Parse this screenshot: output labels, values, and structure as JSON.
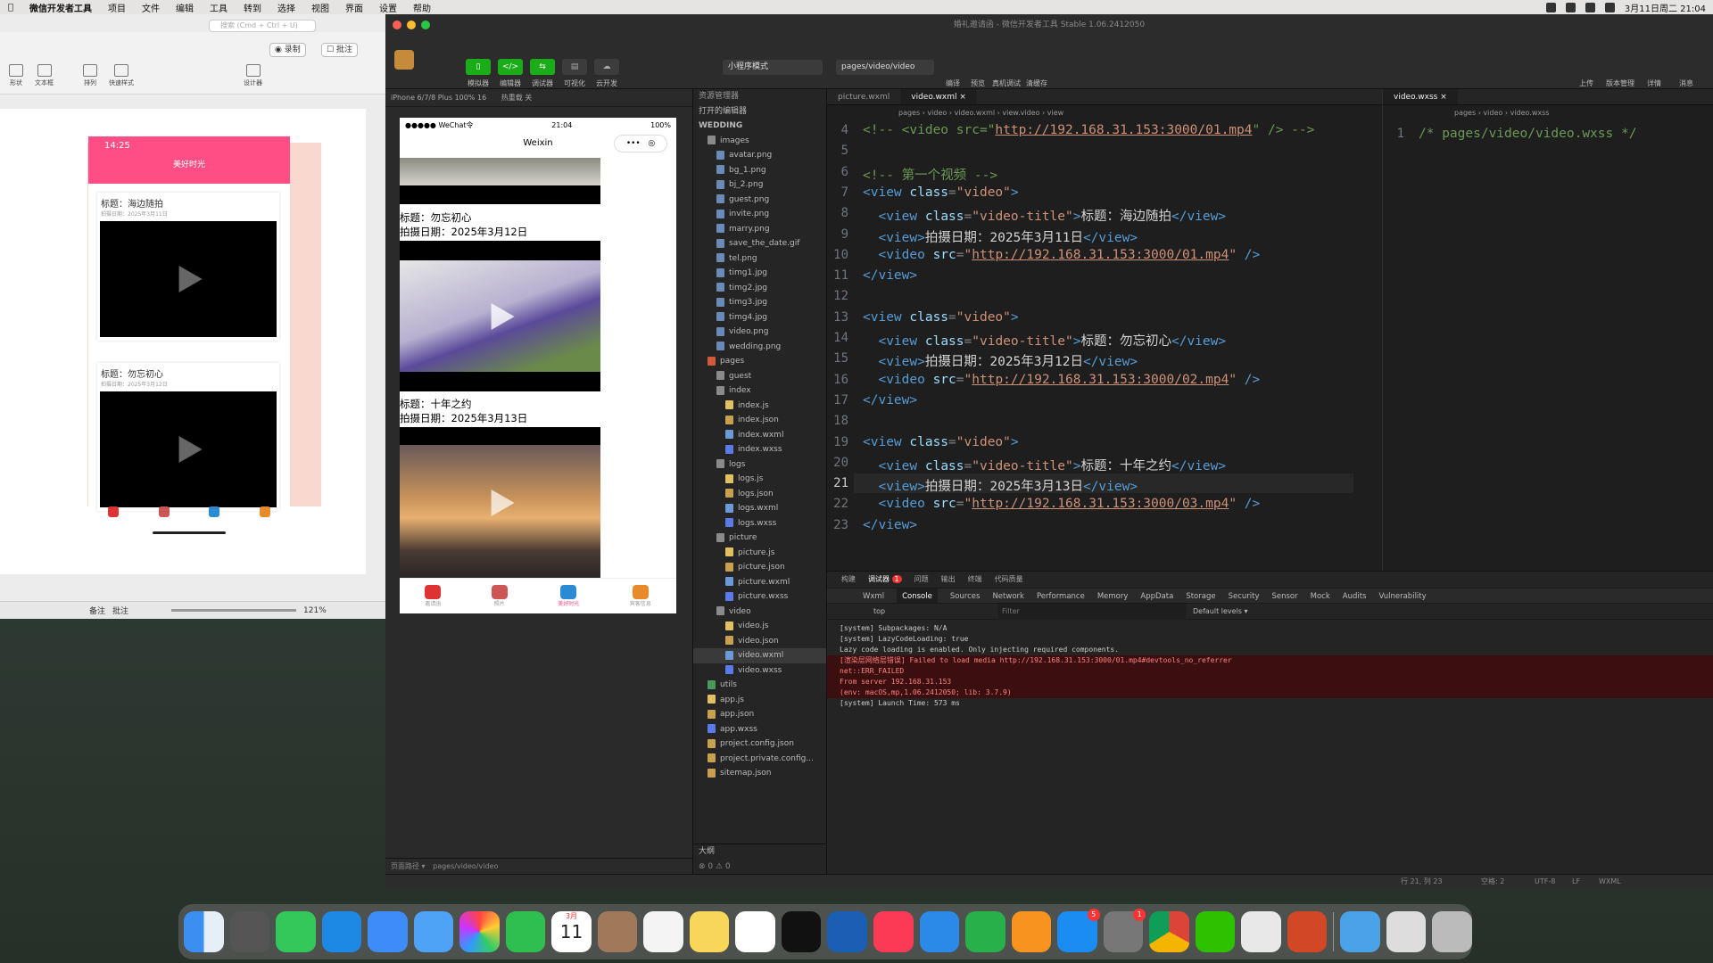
{
  "menubar": {
    "app": "微信开发者工具",
    "items": [
      "项目",
      "文件",
      "编辑",
      "工具",
      "转到",
      "选择",
      "视图",
      "界面",
      "设置",
      "帮助"
    ],
    "datetime": "3月11日周二 21:04"
  },
  "ppt": {
    "search_placeholder": "搜索 (Cmd + Ctrl + U)",
    "record_label": "录制",
    "comment_label": "批注",
    "tools": [
      "形状",
      "文本框",
      "排列",
      "快速样式",
      "设计器"
    ],
    "phone_time": "14:25",
    "phone_title": "美好时光",
    "cards": [
      {
        "title": "标题：海边随拍",
        "date": "拍摄日期：2025年3月11日"
      },
      {
        "title": "标题：勿忘初心",
        "date": "拍摄日期：2025年3月12日"
      }
    ],
    "status_notes": "备注",
    "status_comments": "批注",
    "zoom": "121%"
  },
  "ide": {
    "window_title": "婚礼邀请函 - 微信开发者工具 Stable 1.06.2412050",
    "tool_labels": [
      "模拟器",
      "编辑器",
      "调试器",
      "可视化",
      "云开发"
    ],
    "mode": "小程序模式",
    "page_path": "pages/video/video",
    "right_labels": [
      "编译",
      "预览",
      "真机调试",
      "清缓存"
    ],
    "far_right_labels": [
      "上传",
      "版本管理",
      "详情",
      "消息"
    ],
    "device": "iPhone 6/7/8 Plus 100% 16",
    "network": "热重载 关"
  },
  "phone": {
    "carrier": "●●●●● WeChat令",
    "time": "21:04",
    "battery": "100%",
    "nav_title": "Weixin",
    "items": [
      {
        "title": "标题：勿忘初心",
        "date": "拍摄日期：2025年3月12日"
      },
      {
        "title": "标题：十年之约",
        "date": "拍摄日期：2025年3月13日"
      }
    ],
    "tabs": [
      "邀请函",
      "照片",
      "美好时光",
      "宾客信息"
    ]
  },
  "explorer": {
    "header": "资源管理器",
    "open_editors": "打开的编辑器",
    "project": "WEDDING",
    "rows": [
      {
        "name": "images",
        "depth": 1,
        "type": "folder"
      },
      {
        "name": "avatar.png",
        "depth": 2,
        "type": "img"
      },
      {
        "name": "bg_1.png",
        "depth": 2,
        "type": "img"
      },
      {
        "name": "bj_2.png",
        "depth": 2,
        "type": "img"
      },
      {
        "name": "guest.png",
        "depth": 2,
        "type": "img"
      },
      {
        "name": "invite.png",
        "depth": 2,
        "type": "img"
      },
      {
        "name": "marry.png",
        "depth": 2,
        "type": "img"
      },
      {
        "name": "save_the_date.gif",
        "depth": 2,
        "type": "img"
      },
      {
        "name": "tel.png",
        "depth": 2,
        "type": "img"
      },
      {
        "name": "timg1.jpg",
        "depth": 2,
        "type": "img"
      },
      {
        "name": "timg2.jpg",
        "depth": 2,
        "type": "img"
      },
      {
        "name": "timg3.jpg",
        "depth": 2,
        "type": "img"
      },
      {
        "name": "timg4.jpg",
        "depth": 2,
        "type": "img"
      },
      {
        "name": "video.png",
        "depth": 2,
        "type": "img"
      },
      {
        "name": "wedding.png",
        "depth": 2,
        "type": "img"
      },
      {
        "name": "pages",
        "depth": 1,
        "type": "folder-red"
      },
      {
        "name": "guest",
        "depth": 2,
        "type": "folder"
      },
      {
        "name": "index",
        "depth": 2,
        "type": "folder"
      },
      {
        "name": "index.js",
        "depth": 3,
        "type": "js"
      },
      {
        "name": "index.json",
        "depth": 3,
        "type": "json"
      },
      {
        "name": "index.wxml",
        "depth": 3,
        "type": "wxml"
      },
      {
        "name": "index.wxss",
        "depth": 3,
        "type": "wxss"
      },
      {
        "name": "logs",
        "depth": 2,
        "type": "folder"
      },
      {
        "name": "logs.js",
        "depth": 3,
        "type": "js"
      },
      {
        "name": "logs.json",
        "depth": 3,
        "type": "json"
      },
      {
        "name": "logs.wxml",
        "depth": 3,
        "type": "wxml"
      },
      {
        "name": "logs.wxss",
        "depth": 3,
        "type": "wxss"
      },
      {
        "name": "picture",
        "depth": 2,
        "type": "folder"
      },
      {
        "name": "picture.js",
        "depth": 3,
        "type": "js"
      },
      {
        "name": "picture.json",
        "depth": 3,
        "type": "json"
      },
      {
        "name": "picture.wxml",
        "depth": 3,
        "type": "wxml"
      },
      {
        "name": "picture.wxss",
        "depth": 3,
        "type": "wxss"
      },
      {
        "name": "video",
        "depth": 2,
        "type": "folder"
      },
      {
        "name": "video.js",
        "depth": 3,
        "type": "js"
      },
      {
        "name": "video.json",
        "depth": 3,
        "type": "json"
      },
      {
        "name": "video.wxml",
        "depth": 3,
        "type": "wxml",
        "selected": true
      },
      {
        "name": "video.wxss",
        "depth": 3,
        "type": "wxss"
      },
      {
        "name": "utils",
        "depth": 1,
        "type": "folder-green"
      },
      {
        "name": "app.js",
        "depth": 1,
        "type": "js"
      },
      {
        "name": "app.json",
        "depth": 1,
        "type": "json"
      },
      {
        "name": "app.wxss",
        "depth": 1,
        "type": "wxss"
      },
      {
        "name": "project.config.json",
        "depth": 1,
        "type": "json"
      },
      {
        "name": "project.private.config...",
        "depth": 1,
        "type": "json"
      },
      {
        "name": "sitemap.json",
        "depth": 1,
        "type": "json"
      }
    ],
    "outline": "大纲",
    "errors": "⊗ 0 ⚠ 0"
  },
  "editor": {
    "tabs": [
      "picture.wxml",
      "video.wxml"
    ],
    "breadcrumb": "pages › video › video.wxml › view.video › view",
    "current_line": 21
  },
  "code": [
    {
      "n": 4,
      "parts": [
        [
          "c",
          "<!-- <video src=\""
        ],
        [
          "u",
          "http://192.168.31.153:3000/01.mp4"
        ],
        [
          "c",
          "\" /> -->"
        ]
      ]
    },
    {
      "n": 5,
      "parts": []
    },
    {
      "n": 6,
      "parts": [
        [
          "c",
          "<!-- 第一个视频 -->"
        ]
      ]
    },
    {
      "n": 7,
      "parts": [
        [
          "k",
          "<view "
        ],
        [
          "a",
          "class"
        ],
        [
          "p",
          "="
        ],
        [
          "s",
          "\"video\""
        ],
        [
          "k",
          ">"
        ]
      ]
    },
    {
      "n": 8,
      "parts": [
        [
          "t",
          "  "
        ],
        [
          "k",
          "<view "
        ],
        [
          "a",
          "class"
        ],
        [
          "p",
          "="
        ],
        [
          "s",
          "\"video-title\""
        ],
        [
          "k",
          ">"
        ],
        [
          "t",
          "标题：海边随拍"
        ],
        [
          "k",
          "</view>"
        ]
      ]
    },
    {
      "n": 9,
      "parts": [
        [
          "t",
          "  "
        ],
        [
          "k",
          "<view>"
        ],
        [
          "t",
          "拍摄日期：2025年3月11日"
        ],
        [
          "k",
          "</view>"
        ]
      ]
    },
    {
      "n": 10,
      "parts": [
        [
          "t",
          "  "
        ],
        [
          "k",
          "<video "
        ],
        [
          "a",
          "src"
        ],
        [
          "p",
          "="
        ],
        [
          "s",
          "\""
        ],
        [
          "u",
          "http://192.168.31.153:3000/01.mp4"
        ],
        [
          "s",
          "\""
        ],
        [
          "k",
          " />"
        ]
      ]
    },
    {
      "n": 11,
      "parts": [
        [
          "k",
          "</view>"
        ]
      ]
    },
    {
      "n": 12,
      "parts": []
    },
    {
      "n": 13,
      "parts": [
        [
          "k",
          "<view "
        ],
        [
          "a",
          "class"
        ],
        [
          "p",
          "="
        ],
        [
          "s",
          "\"video\""
        ],
        [
          "k",
          ">"
        ]
      ]
    },
    {
      "n": 14,
      "parts": [
        [
          "t",
          "  "
        ],
        [
          "k",
          "<view "
        ],
        [
          "a",
          "class"
        ],
        [
          "p",
          "="
        ],
        [
          "s",
          "\"video-title\""
        ],
        [
          "k",
          ">"
        ],
        [
          "t",
          "标题：勿忘初心"
        ],
        [
          "k",
          "</view>"
        ]
      ]
    },
    {
      "n": 15,
      "parts": [
        [
          "t",
          "  "
        ],
        [
          "k",
          "<view>"
        ],
        [
          "t",
          "拍摄日期：2025年3月12日"
        ],
        [
          "k",
          "</view>"
        ]
      ]
    },
    {
      "n": 16,
      "parts": [
        [
          "t",
          "  "
        ],
        [
          "k",
          "<video "
        ],
        [
          "a",
          "src"
        ],
        [
          "p",
          "="
        ],
        [
          "s",
          "\""
        ],
        [
          "u",
          "http://192.168.31.153:3000/02.mp4"
        ],
        [
          "s",
          "\""
        ],
        [
          "k",
          " />"
        ]
      ]
    },
    {
      "n": 17,
      "parts": [
        [
          "k",
          "</view>"
        ]
      ]
    },
    {
      "n": 18,
      "parts": []
    },
    {
      "n": 19,
      "parts": [
        [
          "k",
          "<view "
        ],
        [
          "a",
          "class"
        ],
        [
          "p",
          "="
        ],
        [
          "s",
          "\"video\""
        ],
        [
          "k",
          ">"
        ]
      ]
    },
    {
      "n": 20,
      "parts": [
        [
          "t",
          "  "
        ],
        [
          "k",
          "<view "
        ],
        [
          "a",
          "class"
        ],
        [
          "p",
          "="
        ],
        [
          "s",
          "\"video-title\""
        ],
        [
          "k",
          ">"
        ],
        [
          "t",
          "标题：十年之约"
        ],
        [
          "k",
          "</view>"
        ]
      ]
    },
    {
      "n": 21,
      "parts": [
        [
          "t",
          "  "
        ],
        [
          "k",
          "<view>"
        ],
        [
          "t",
          "拍摄日期：2025年3月13日"
        ],
        [
          "k",
          "</view>"
        ]
      ]
    },
    {
      "n": 22,
      "parts": [
        [
          "t",
          "  "
        ],
        [
          "k",
          "<video "
        ],
        [
          "a",
          "src"
        ],
        [
          "p",
          "="
        ],
        [
          "s",
          "\""
        ],
        [
          "u",
          "http://192.168.31.153:3000/03.mp4"
        ],
        [
          "s",
          "\""
        ],
        [
          "k",
          " />"
        ]
      ]
    },
    {
      "n": 23,
      "parts": [
        [
          "k",
          "</view>"
        ]
      ]
    }
  ],
  "wxss": {
    "tab": "video.wxss",
    "breadcrumb": "pages › video › video.wxss",
    "line_no": "1",
    "line": "/* pages/video/video.wxss */"
  },
  "debug": {
    "tabs": [
      "构建",
      "调试器",
      "问题",
      "输出",
      "终端",
      "代码质量"
    ],
    "badge": "1",
    "devtabs": [
      "Wxml",
      "Console",
      "Sources",
      "Network",
      "Performance",
      "Memory",
      "AppData",
      "Storage",
      "Security",
      "Sensor",
      "Mock",
      "Audits",
      "Vulnerability"
    ],
    "context": "top",
    "filter": "Filter",
    "levels": "Default levels ▾",
    "logs": [
      {
        "text": "[system] Subpackages: N/A",
        "err": false
      },
      {
        "text": "[system] LazyCodeLoading: true",
        "err": false
      },
      {
        "text": "Lazy code loading is enabled. Only injecting required components.",
        "err": false
      },
      {
        "text": "[渲染层网络层错误] Failed to load media http://192.168.31.153:3000/01.mp4#devtools_no_referrer",
        "err": true
      },
      {
        "text": "net::ERR_FAILED",
        "err": true
      },
      {
        "text": "From server 192.168.31.153",
        "err": true
      },
      {
        "text": "(env: macOS,mp,1.06.2412050; lib: 3.7.9)",
        "err": true
      },
      {
        "text": "[system] Launch Time: 573 ms",
        "err": false
      }
    ]
  },
  "statusbar": {
    "path_label": "页面路径 ▾",
    "path": "pages/video/video",
    "position": "行 21, 列 23",
    "spaces": "空格: 2",
    "encoding": "UTF-8",
    "eol": "LF",
    "lang": "WXML"
  },
  "dock": {
    "calendar_month": "3月",
    "calendar_day": "11"
  },
  "colors": {
    "wechat_green": "#1aad19",
    "pink": "#ff4d85"
  }
}
